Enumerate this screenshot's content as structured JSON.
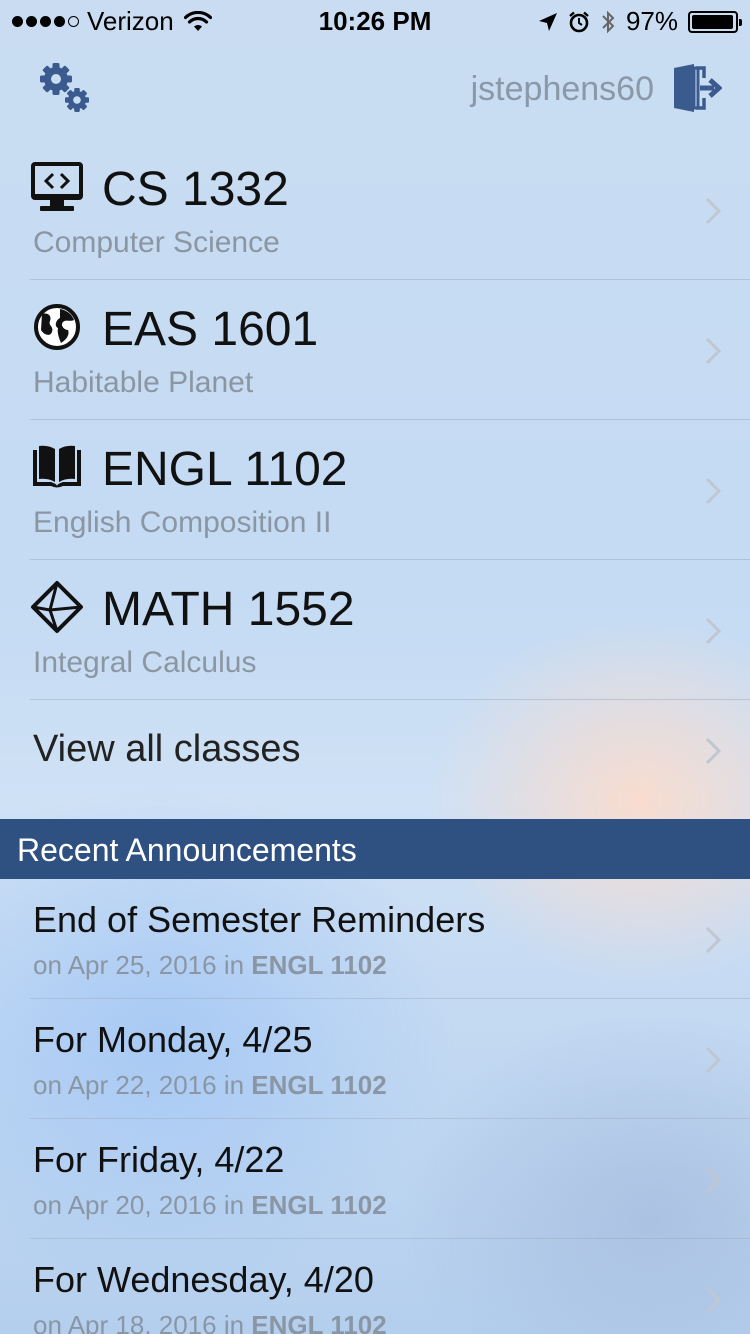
{
  "status_bar": {
    "carrier": "Verizon",
    "time": "10:26 PM",
    "battery_percent": "97%",
    "battery_level": 0.97
  },
  "header": {
    "settings_icon": "gears-icon",
    "username": "jstephens60",
    "logout_icon": "logout-door-icon"
  },
  "classes": [
    {
      "code": "CS 1332",
      "name": "Computer Science",
      "icon": "computer-monitor-icon"
    },
    {
      "code": "EAS 1601",
      "name": "Habitable Planet",
      "icon": "globe-icon"
    },
    {
      "code": "ENGL 1102",
      "name": "English Composition II",
      "icon": "open-book-icon"
    },
    {
      "code": "MATH 1552",
      "name": "Integral Calculus",
      "icon": "geometry-shape-icon"
    }
  ],
  "view_all_label": "View all classes",
  "announcements_header": "Recent Announcements",
  "announcements": [
    {
      "title": "End of Semester Reminders",
      "meta_prefix": "on Apr 25, 2016 in",
      "course": "ENGL 1102"
    },
    {
      "title": "For Monday, 4/25",
      "meta_prefix": "on Apr 22, 2016 in",
      "course": "ENGL 1102"
    },
    {
      "title": "For Friday, 4/22",
      "meta_prefix": "on Apr 20, 2016 in",
      "course": "ENGL 1102"
    },
    {
      "title": "For Wednesday, 4/20",
      "meta_prefix": "on Apr 18, 2016 in",
      "course": "ENGL 1102"
    }
  ],
  "colors": {
    "accent": "#2f5182",
    "icon_blue": "#3b5b8e",
    "secondary_text": "#8b96a3"
  }
}
